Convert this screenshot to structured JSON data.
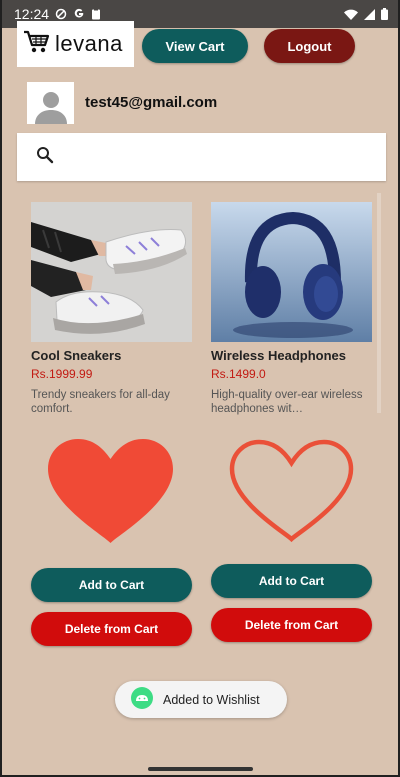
{
  "status_bar": {
    "time": "12:24"
  },
  "header": {
    "logo_text": "levana",
    "view_cart_label": "View Cart",
    "logout_label": "Logout"
  },
  "user": {
    "email": "test45@gmail.com"
  },
  "search": {
    "placeholder": "",
    "value": ""
  },
  "products": [
    {
      "name": "Cool Sneakers",
      "price": "Rs.1999.99",
      "description": "Trendy sneakers for all-day comfort.",
      "wishlisted": true,
      "add_label": "Add to Cart",
      "delete_label": "Delete from Cart"
    },
    {
      "name": "Wireless Headphones",
      "price": "Rs.1499.0",
      "description": "High-quality over-ear wireless headphones wit…",
      "wishlisted": false,
      "add_label": "Add to Cart",
      "delete_label": "Delete from Cart"
    }
  ],
  "toast": {
    "message": "Added to Wishlist"
  },
  "colors": {
    "background": "#d9c3b0",
    "primary_teal": "#0e5c5c",
    "logout_red": "#7a1713",
    "delete_red": "#d10c0c",
    "price_red": "#c21a12",
    "heart_red": "#f04a36"
  },
  "icons": {
    "cart": "cart-icon",
    "search": "search-icon",
    "avatar": "person-icon",
    "heart_filled": "heart-filled-icon",
    "heart_outline": "heart-outline-icon",
    "toast": "android-app-icon"
  }
}
